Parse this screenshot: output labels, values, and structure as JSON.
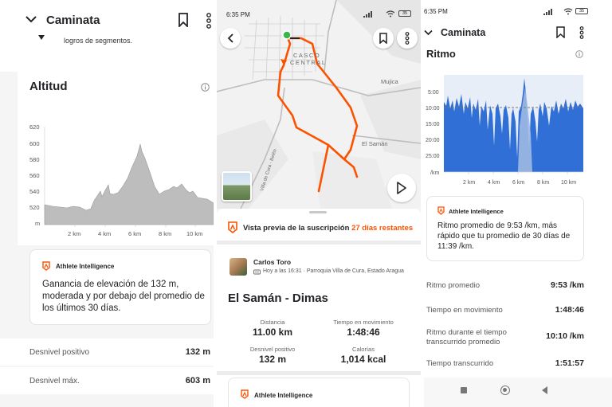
{
  "screen1": {
    "header": {
      "title": "Caminata"
    },
    "segments_note": "logros de segmentos.",
    "altitude": {
      "title": "Altitud",
      "y_ticks": [
        "620",
        "600",
        "580",
        "560",
        "540",
        "520",
        "m"
      ],
      "x_ticks": [
        "2 km",
        "4 km",
        "6 km",
        "8 km",
        "10 km"
      ]
    },
    "ai_card": {
      "label": "Athlete Intelligence",
      "text_lines": [
        "Ganancia de elevación de 132 m,",
        "moderada y por debajo del promedio de",
        "los últimos 30 días."
      ]
    },
    "stats": [
      {
        "label": "Desnivel positivo",
        "value": "132 m"
      },
      {
        "label": "Desnivel máx.",
        "value": "603 m"
      }
    ]
  },
  "screen2": {
    "status": {
      "time": "6:35 PM",
      "battery": "35"
    },
    "map_labels": {
      "casco": "CASCO",
      "central": "CENTRAL",
      "mujica": "Mujica",
      "el_saman": "El Samán",
      "road": "Villa de Cura - Belén"
    },
    "preview": {
      "text": "Vista previa de la suscripción",
      "days": "27 días restantes"
    },
    "athlete": {
      "name": "Carlos Toro",
      "meta": "Hoy a las 16:31 · Parroquia Villa de Cura, Estado Aragua"
    },
    "activity_title": "El Samán - Dimas",
    "metrics": [
      {
        "label": "Distancia",
        "value": "11.00 km"
      },
      {
        "label": "Tiempo en movimiento",
        "value": "1:48:46"
      },
      {
        "label": "Desnivel positivo",
        "value": "132 m"
      },
      {
        "label": "Calorías",
        "value": "1,014 kcal"
      }
    ],
    "ai_label": "Athlete Intelligence"
  },
  "screen3": {
    "status": {
      "time": "6:35 PM",
      "battery": "35"
    },
    "header": {
      "title": "Caminata"
    },
    "section": "Ritmo",
    "pace_chart": {
      "y_ticks": [
        "5:00",
        "10:00",
        "15:00",
        "20:00",
        "25:00",
        "/km"
      ],
      "x_ticks": [
        "2 km",
        "4 km",
        "6 km",
        "8 km",
        "10 km"
      ]
    },
    "ai_card": {
      "label": "Athlete Intelligence",
      "text_lines": [
        "Ritmo promedio de 9:53 /km, más",
        "rápido que tu promedio de 30 días de",
        "11:39 /km."
      ]
    },
    "stats": [
      {
        "label": "Ritmo promedio",
        "value": "9:53 /km"
      },
      {
        "label": "Tiempo en movimiento",
        "value": "1:48:46"
      },
      {
        "label_line1": "Ritmo durante el tiempo",
        "label_line2": "transcurrido promedio",
        "value": "10:10 /km"
      },
      {
        "label": "Tiempo transcurrido",
        "value": "1:51:57"
      }
    ]
  },
  "colors": {
    "accent": "#fc5200",
    "pace_blue": "#2f6fd6",
    "elevation_gray": "#bdbdbd"
  }
}
